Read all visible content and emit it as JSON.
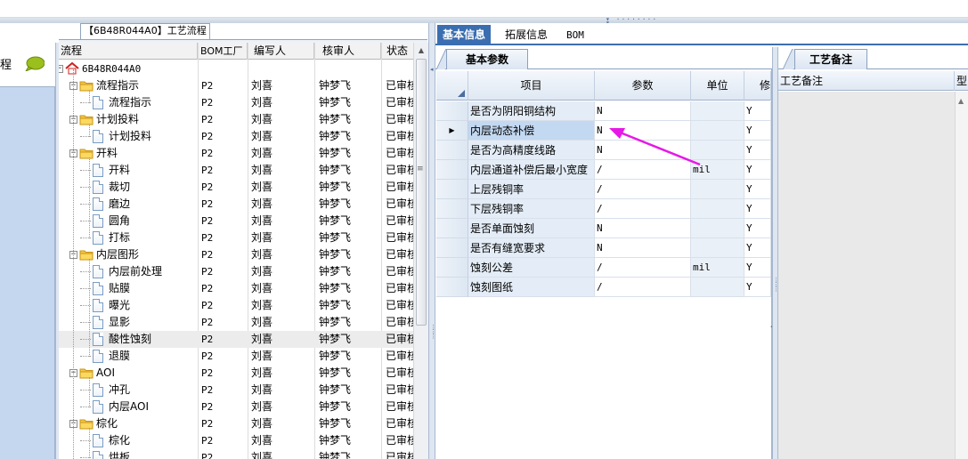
{
  "tree_panel": {
    "title": "【6B48R044A0】工艺流程",
    "columns": [
      "流程",
      "BOM工厂",
      "编写人",
      "核审人",
      "状态"
    ],
    "rows": [
      {
        "name": "6B48R044A0",
        "level": 0,
        "type": "root",
        "plant": "",
        "author": "",
        "reviewer": "",
        "status": ""
      },
      {
        "name": "流程指示",
        "level": 1,
        "type": "folder",
        "plant": "P2",
        "author": "刘喜",
        "reviewer": "钟梦飞",
        "status": "已审核"
      },
      {
        "name": "流程指示",
        "level": 2,
        "type": "doc",
        "plant": "P2",
        "author": "刘喜",
        "reviewer": "钟梦飞",
        "status": "已审核"
      },
      {
        "name": "计划投料",
        "level": 1,
        "type": "folder",
        "plant": "P2",
        "author": "刘喜",
        "reviewer": "钟梦飞",
        "status": "已审核"
      },
      {
        "name": "计划投料",
        "level": 2,
        "type": "doc",
        "plant": "P2",
        "author": "刘喜",
        "reviewer": "钟梦飞",
        "status": "已审核"
      },
      {
        "name": "开料",
        "level": 1,
        "type": "folder",
        "plant": "P2",
        "author": "刘喜",
        "reviewer": "钟梦飞",
        "status": "已审核"
      },
      {
        "name": "开料",
        "level": 2,
        "type": "doc",
        "plant": "P2",
        "author": "刘喜",
        "reviewer": "钟梦飞",
        "status": "已审核"
      },
      {
        "name": "裁切",
        "level": 2,
        "type": "doc",
        "plant": "P2",
        "author": "刘喜",
        "reviewer": "钟梦飞",
        "status": "已审核"
      },
      {
        "name": "磨边",
        "level": 2,
        "type": "doc",
        "plant": "P2",
        "author": "刘喜",
        "reviewer": "钟梦飞",
        "status": "已审核"
      },
      {
        "name": "圆角",
        "level": 2,
        "type": "doc",
        "plant": "P2",
        "author": "刘喜",
        "reviewer": "钟梦飞",
        "status": "已审核"
      },
      {
        "name": "打标",
        "level": 2,
        "type": "doc",
        "plant": "P2",
        "author": "刘喜",
        "reviewer": "钟梦飞",
        "status": "已审核"
      },
      {
        "name": "内层图形",
        "level": 1,
        "type": "folder",
        "plant": "P2",
        "author": "刘喜",
        "reviewer": "钟梦飞",
        "status": "已审核"
      },
      {
        "name": "内层前处理",
        "level": 2,
        "type": "doc",
        "plant": "P2",
        "author": "刘喜",
        "reviewer": "钟梦飞",
        "status": "已审核"
      },
      {
        "name": "贴膜",
        "level": 2,
        "type": "doc",
        "plant": "P2",
        "author": "刘喜",
        "reviewer": "钟梦飞",
        "status": "已审核"
      },
      {
        "name": "曝光",
        "level": 2,
        "type": "doc",
        "plant": "P2",
        "author": "刘喜",
        "reviewer": "钟梦飞",
        "status": "已审核"
      },
      {
        "name": "显影",
        "level": 2,
        "type": "doc",
        "plant": "P2",
        "author": "刘喜",
        "reviewer": "钟梦飞",
        "status": "已审核"
      },
      {
        "name": "酸性蚀刻",
        "level": 2,
        "type": "doc",
        "plant": "P2",
        "author": "刘喜",
        "reviewer": "钟梦飞",
        "status": "已审核",
        "selected": true
      },
      {
        "name": "退膜",
        "level": 2,
        "type": "doc",
        "plant": "P2",
        "author": "刘喜",
        "reviewer": "钟梦飞",
        "status": "已审核"
      },
      {
        "name": "AOI",
        "level": 1,
        "type": "folder",
        "plant": "P2",
        "author": "刘喜",
        "reviewer": "钟梦飞",
        "status": "已审核"
      },
      {
        "name": "冲孔",
        "level": 2,
        "type": "doc",
        "plant": "P2",
        "author": "刘喜",
        "reviewer": "钟梦飞",
        "status": "已审核"
      },
      {
        "name": "内层AOI",
        "level": 2,
        "type": "doc",
        "plant": "P2",
        "author": "刘喜",
        "reviewer": "钟梦飞",
        "status": "已审核"
      },
      {
        "name": "棕化",
        "level": 1,
        "type": "folder",
        "plant": "P2",
        "author": "刘喜",
        "reviewer": "钟梦飞",
        "status": "已审核"
      },
      {
        "name": "棕化",
        "level": 2,
        "type": "doc",
        "plant": "P2",
        "author": "刘喜",
        "reviewer": "钟梦飞",
        "status": "已审核"
      },
      {
        "name": "烘板",
        "level": 2,
        "type": "doc",
        "plant": "P2",
        "author": "刘喜",
        "reviewer": "钟梦飞",
        "status": "已审核"
      }
    ]
  },
  "left_panel": {
    "label": "程"
  },
  "main_tabs": [
    "基本信息",
    "拓展信息",
    "BOM"
  ],
  "params_panel": {
    "tab": "基本参数",
    "columns": [
      "项目",
      "参数",
      "单位",
      "修"
    ],
    "rows": [
      {
        "item": "是否为阴阳铜结构",
        "value": "N",
        "unit": "",
        "mod": "Y"
      },
      {
        "item": "内层动态补偿",
        "value": "N",
        "unit": "",
        "mod": "Y",
        "current": true
      },
      {
        "item": "是否为高精度线路",
        "value": "N",
        "unit": "",
        "mod": "Y"
      },
      {
        "item": "内层通道补偿后最小宽度",
        "value": "/",
        "unit": "mil",
        "mod": "Y"
      },
      {
        "item": "上层残铜率",
        "value": "/",
        "unit": "",
        "mod": "Y"
      },
      {
        "item": "下层残铜率",
        "value": "/",
        "unit": "",
        "mod": "Y"
      },
      {
        "item": "是否单面蚀刻",
        "value": "N",
        "unit": "",
        "mod": "Y"
      },
      {
        "item": "是否有缝宽要求",
        "value": "N",
        "unit": "",
        "mod": "Y"
      },
      {
        "item": "蚀刻公差",
        "value": "/",
        "unit": "mil",
        "mod": "Y"
      },
      {
        "item": "蚀刻图纸",
        "value": "/",
        "unit": "",
        "mod": "Y"
      }
    ]
  },
  "notes_panel": {
    "tab": "工艺备注",
    "columns": [
      "工艺备注",
      "型"
    ]
  },
  "annotation": {
    "color": "#e619e6"
  }
}
